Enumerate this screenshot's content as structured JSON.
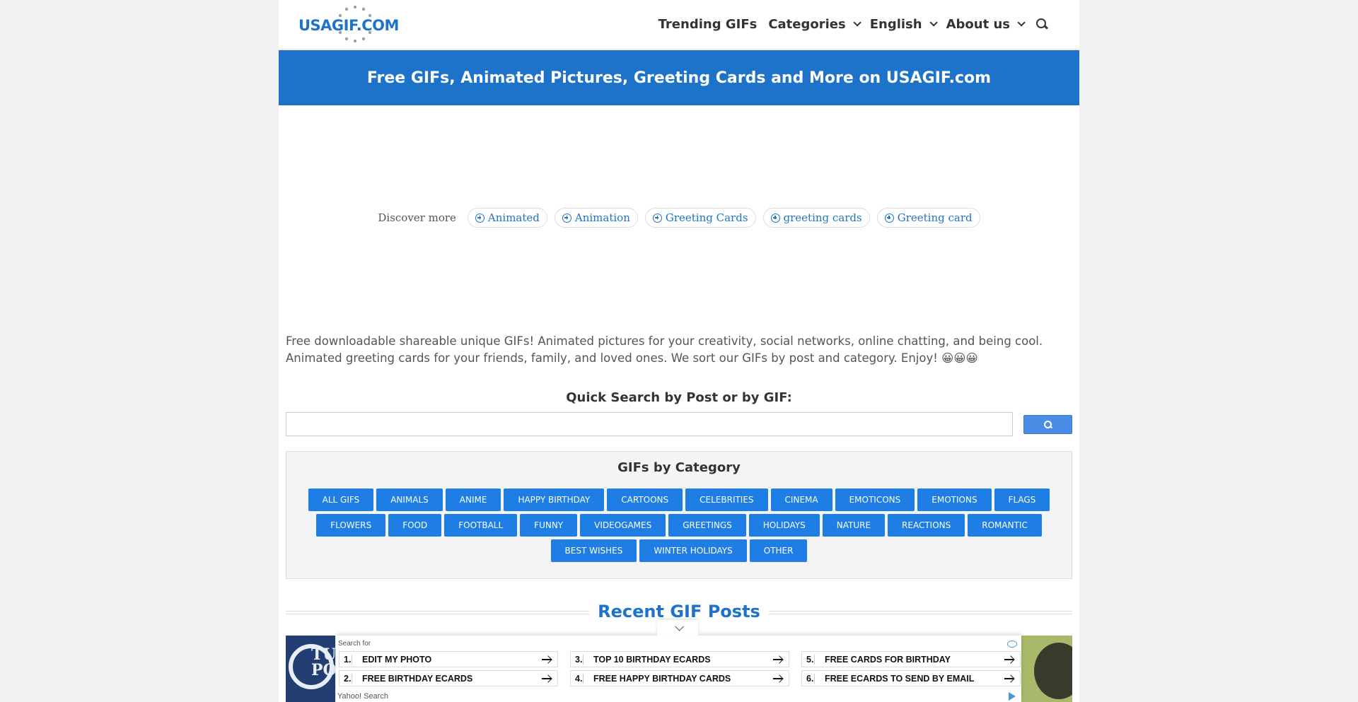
{
  "header": {
    "logo_text": "USAGIF.COM",
    "nav": [
      {
        "label": "Trending GIFs"
      },
      {
        "label": "Categories"
      },
      {
        "label": "English"
      },
      {
        "label": "About us"
      }
    ]
  },
  "banner": {
    "title": "Free GIFs, Animated Pictures, Greeting Cards and More on USAGIF.com"
  },
  "discover": {
    "label": "Discover more",
    "pills": [
      "Animated",
      "Animation",
      "Greeting Cards",
      "greeting cards",
      "Greeting card"
    ]
  },
  "intro": "Free downloadable shareable unique GIFs! Animated pictures for your creativity, social networks, online chatting, and being cool. Animated greeting cards for your friends, family, and loved ones. We sort our GIFs by post and category. Enjoy! 😀😀😀",
  "quick_search": {
    "title": "Quick Search by Post or by GIF:",
    "value": "",
    "placeholder": ""
  },
  "categories": {
    "title": "GIFs by Category",
    "rows": [
      [
        "All GIFs",
        "Animals",
        "Anime",
        "Happy Birthday",
        "Cartoons",
        "Celebrities",
        "Cinema",
        "Emoticons",
        "Emotions",
        "Flags"
      ],
      [
        "Flowers",
        "Food",
        "Football",
        "Funny",
        "Videogames",
        "Greetings",
        "Holidays",
        "Nature",
        "Reactions",
        "Romantic"
      ],
      [
        "Best Wishes",
        "Winter Holidays",
        "Other"
      ]
    ]
  },
  "recent": {
    "title": "Recent GIF Posts",
    "thumb_text": "TU PO"
  },
  "ad": {
    "search_for": "Search for",
    "links": [
      {
        "num": "1.",
        "text": "Edit my photo"
      },
      {
        "num": "3.",
        "text": "Top 10 Birthday Ecards"
      },
      {
        "num": "5.",
        "text": "Free Cards For Birthday"
      },
      {
        "num": "2.",
        "text": "Free Birthday Ecards"
      },
      {
        "num": "4.",
        "text": "Free Happy Birthday Cards"
      },
      {
        "num": "6.",
        "text": "Free Ecards To Send By Email"
      }
    ],
    "footer": "Yahoo! Search"
  }
}
